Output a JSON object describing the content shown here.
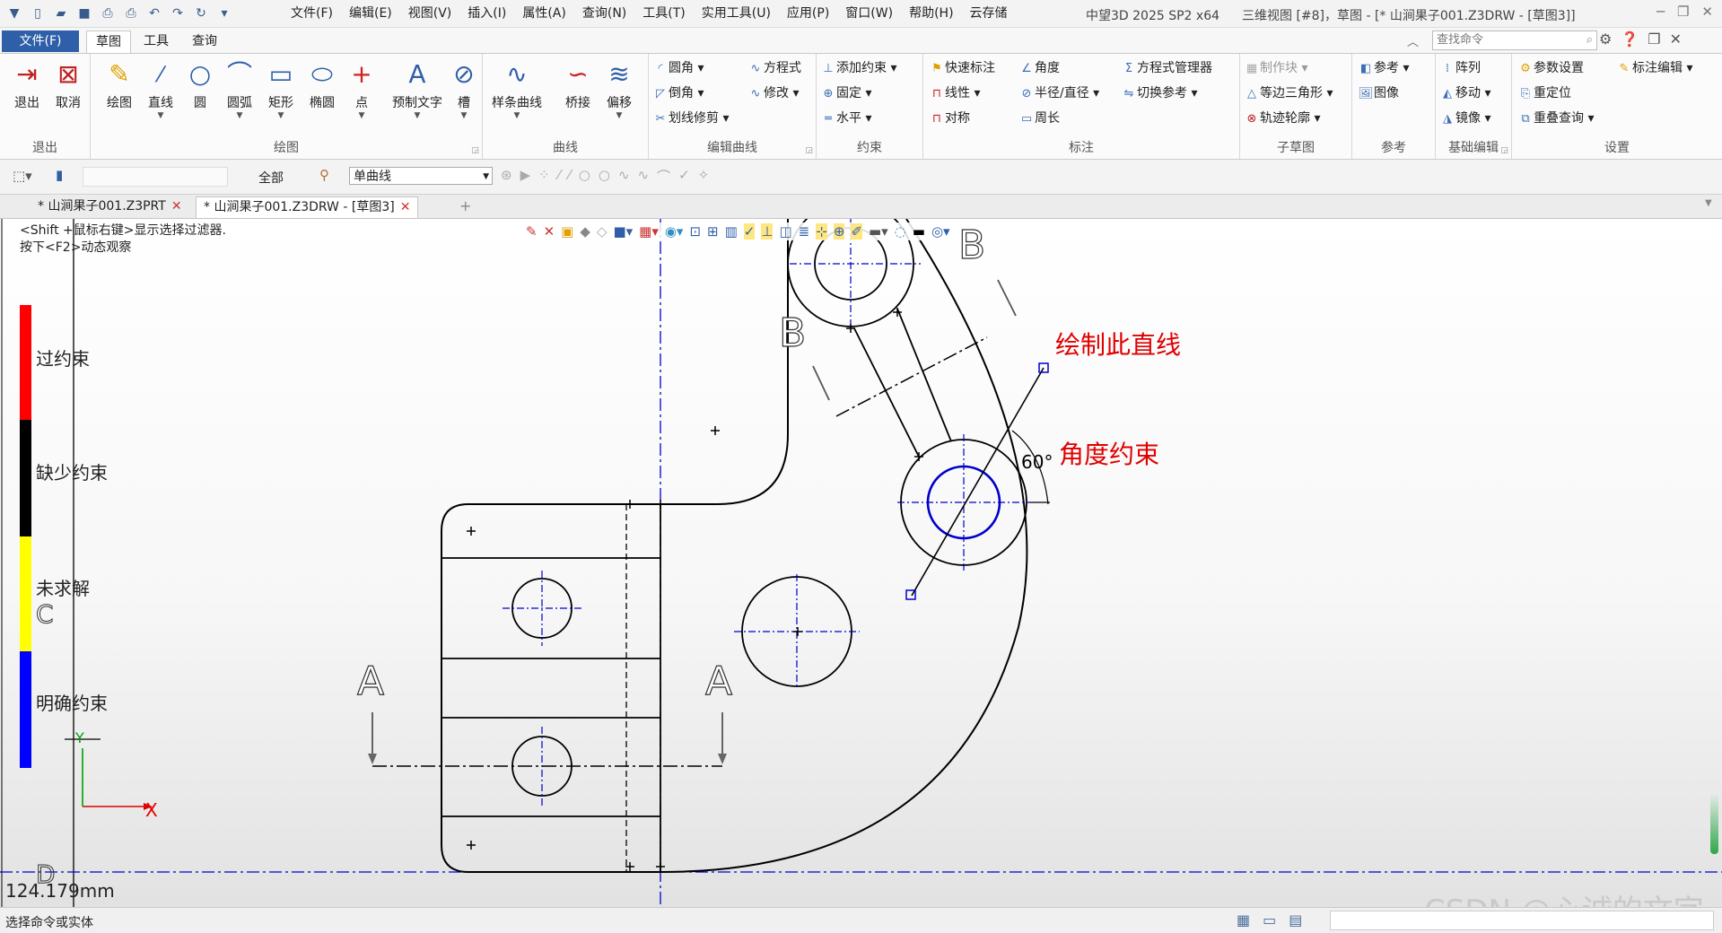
{
  "app": {
    "window_title": "中望3D 2025 SP2 x64",
    "document_title": "三维视图 [#8]，草图 - [* 山涧果子001.Z3DRW - [草图3]]"
  },
  "menu": [
    "文件(F)",
    "编辑(E)",
    "视图(V)",
    "插入(I)",
    "属性(A)",
    "查询(N)",
    "工具(T)",
    "实用工具(U)",
    "应用(P)",
    "窗口(W)",
    "帮助(H)",
    "云存储"
  ],
  "ribbon_tabs": {
    "file": "文件(F)",
    "tabs": [
      "草图",
      "工具",
      "查询"
    ]
  },
  "search": {
    "placeholder": "查找命令"
  },
  "ribbon": {
    "exit_group": {
      "label": "退出",
      "exit": "退出",
      "cancel": "取消"
    },
    "draw_group": {
      "label": "绘图",
      "buttons": [
        "绘图",
        "直线",
        "圆",
        "圆弧",
        "矩形",
        "椭圆",
        "点",
        "预制文字",
        "槽"
      ]
    },
    "curve_group": {
      "label": "曲线",
      "buttons": [
        "样条曲线",
        "桥接",
        "偏移"
      ]
    },
    "edit_group": {
      "label": "编辑曲线",
      "items": [
        "圆角",
        "倒角",
        "划线修剪",
        "方程式",
        "修改"
      ]
    },
    "constraint_group": {
      "label": "约束",
      "items": [
        "添加约束",
        "固定",
        "水平"
      ]
    },
    "annotation_group": {
      "label": "标注",
      "items": [
        "快速标注",
        "线性",
        "对称",
        "角度",
        "半径/直径",
        "周长",
        "方程式管理器",
        "切换参考"
      ]
    },
    "subsketch_group": {
      "label": "子草图",
      "items": [
        "制作块",
        "等边三角形",
        "轨迹轮廓"
      ]
    },
    "reference_group": {
      "label": "参考",
      "items": [
        "参考",
        "图像"
      ]
    },
    "basic_edit_group": {
      "label": "基础编辑",
      "items": [
        "阵列",
        "移动",
        "镜像"
      ]
    },
    "settings_group": {
      "label": "设置",
      "items": [
        "参数设置",
        "标注编辑",
        "重定位",
        "重叠查询"
      ]
    }
  },
  "toolbar2": {
    "filter_all": "全部",
    "curve_mode": "单曲线"
  },
  "doc_tabs": [
    {
      "label": "* 山涧果子001.Z3PRT",
      "active": false
    },
    {
      "label": "* 山涧果子001.Z3DRW - [草图3]",
      "active": true
    }
  ],
  "canvas": {
    "hint1": "<Shift +鼠标右键>显示选择过滤器.",
    "hint2": "按下<F2>动态观察",
    "measurement": "124.179mm",
    "annotation_line": "绘制此直线",
    "annotation_angle": "角度约束",
    "angle_value": "60°",
    "section_labels": {
      "a_left": "A",
      "a_right": "A",
      "b_top": "B",
      "b_left": "B",
      "c": "C",
      "d": "D"
    },
    "axis_x": "X",
    "axis_y": "Y",
    "constraint_legend": [
      {
        "label": "过约束",
        "color": "#ff0000"
      },
      {
        "label": "缺少约束",
        "color": "#000000"
      },
      {
        "label": "未求解",
        "color": "#ffff00"
      },
      {
        "label": "明确约束",
        "color": "#0000ff"
      }
    ],
    "watermark": "CSDN @心诚的文字"
  },
  "status": {
    "text": "选择命令或实体"
  },
  "colors": {
    "accent": "#2f5fa8",
    "annotation_red": "#e00000",
    "centerline": "#0000cc"
  }
}
